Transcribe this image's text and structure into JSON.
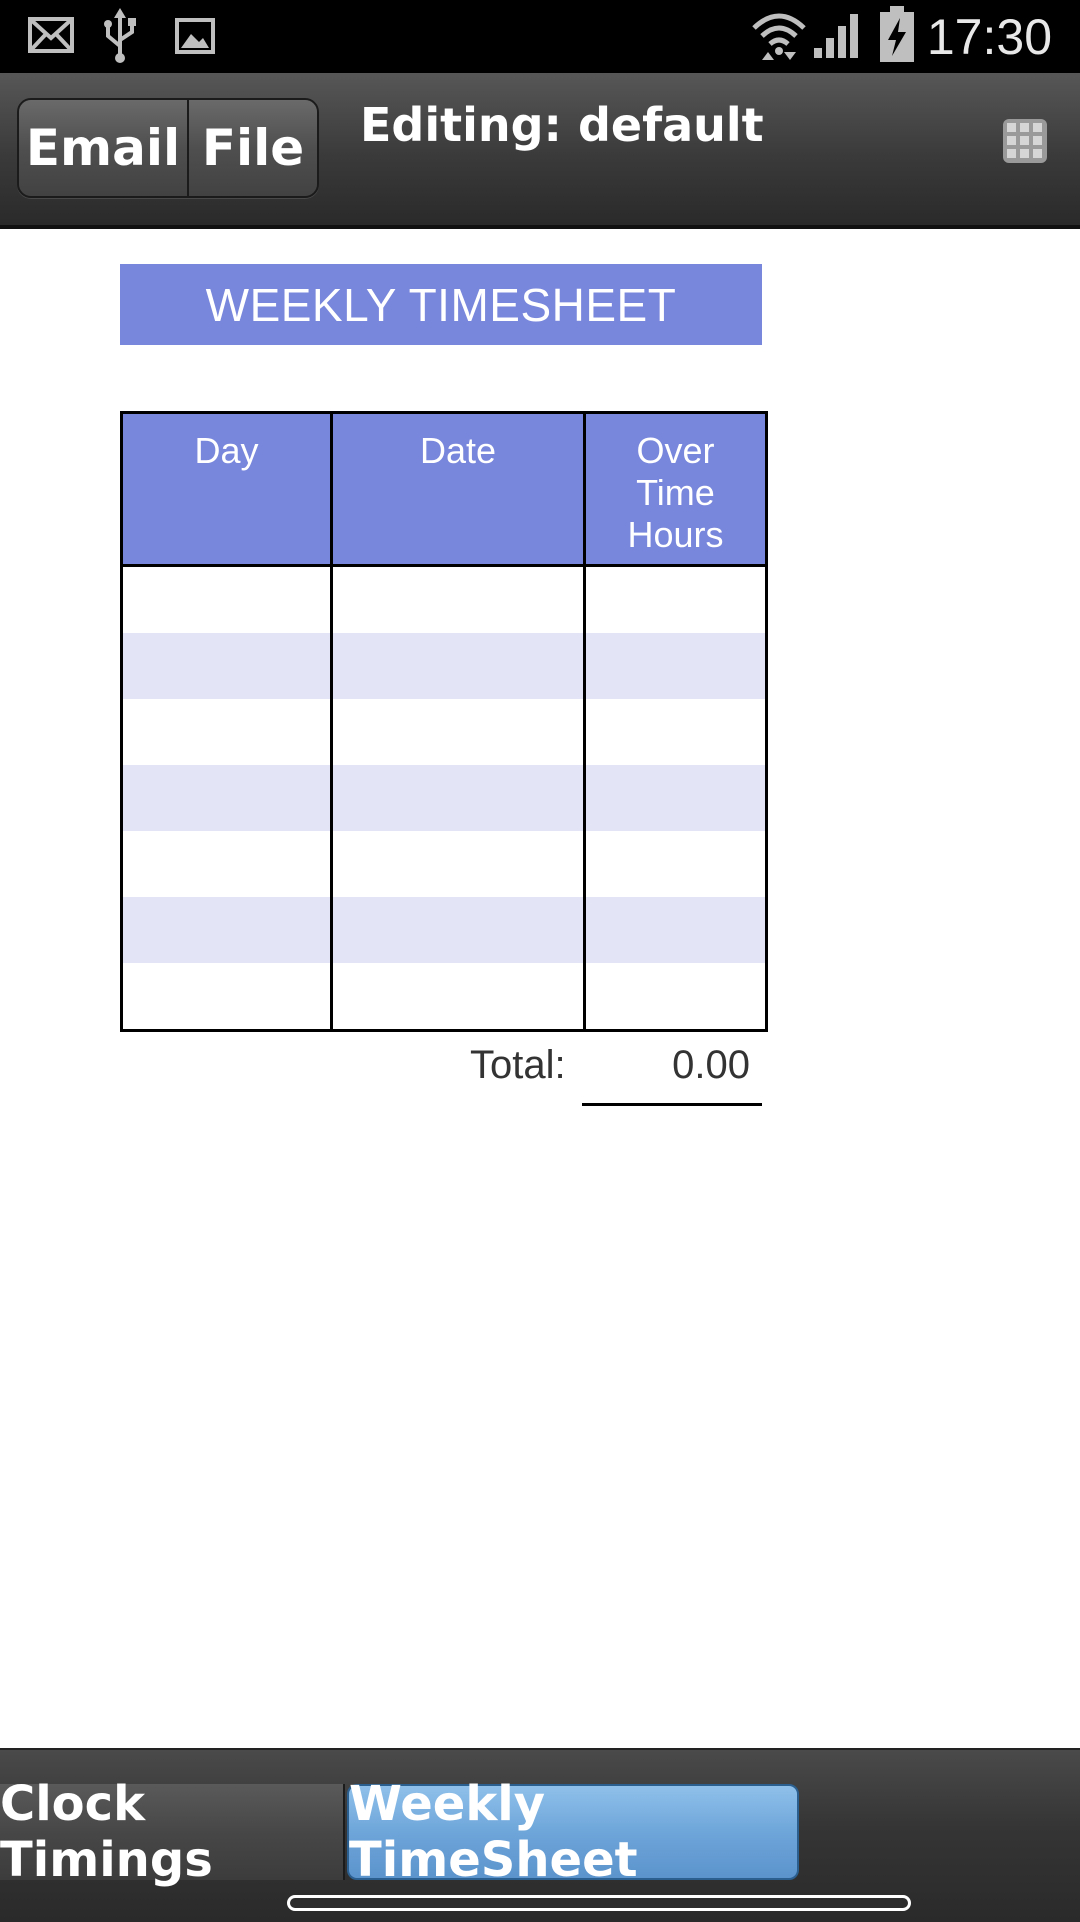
{
  "status_bar": {
    "time": "17:30",
    "left_icons": [
      "email-icon",
      "usb-icon",
      "image-icon"
    ],
    "right_icons": [
      "wifi-icon",
      "signal-icon",
      "battery-charging-icon"
    ]
  },
  "action_bar": {
    "email_label": "Email",
    "file_label": "File",
    "title": "Editing: default",
    "menu_icon": "grid-icon"
  },
  "timesheet": {
    "banner": "WEEKLY TIMESHEET",
    "headers": {
      "day": "Day",
      "date": "Date",
      "overtime_line1": "Over",
      "overtime_line2": "Time",
      "overtime_line3": "Hours"
    },
    "rows": [
      {
        "day": "",
        "date": "",
        "overtime": ""
      },
      {
        "day": "",
        "date": "",
        "overtime": ""
      },
      {
        "day": "",
        "date": "",
        "overtime": ""
      },
      {
        "day": "",
        "date": "",
        "overtime": ""
      },
      {
        "day": "",
        "date": "",
        "overtime": ""
      },
      {
        "day": "",
        "date": "",
        "overtime": ""
      },
      {
        "day": "",
        "date": "",
        "overtime": ""
      }
    ],
    "total_label": "Total:",
    "total_value": "0.00"
  },
  "tabs": [
    {
      "label": "Clock Timings",
      "active": false
    },
    {
      "label": "Weekly TimeSheet",
      "active": true
    }
  ],
  "colors": {
    "header_blue": "#7886dc",
    "row_alt": "#e3e5f7",
    "active_tab": "#6ea6da"
  }
}
